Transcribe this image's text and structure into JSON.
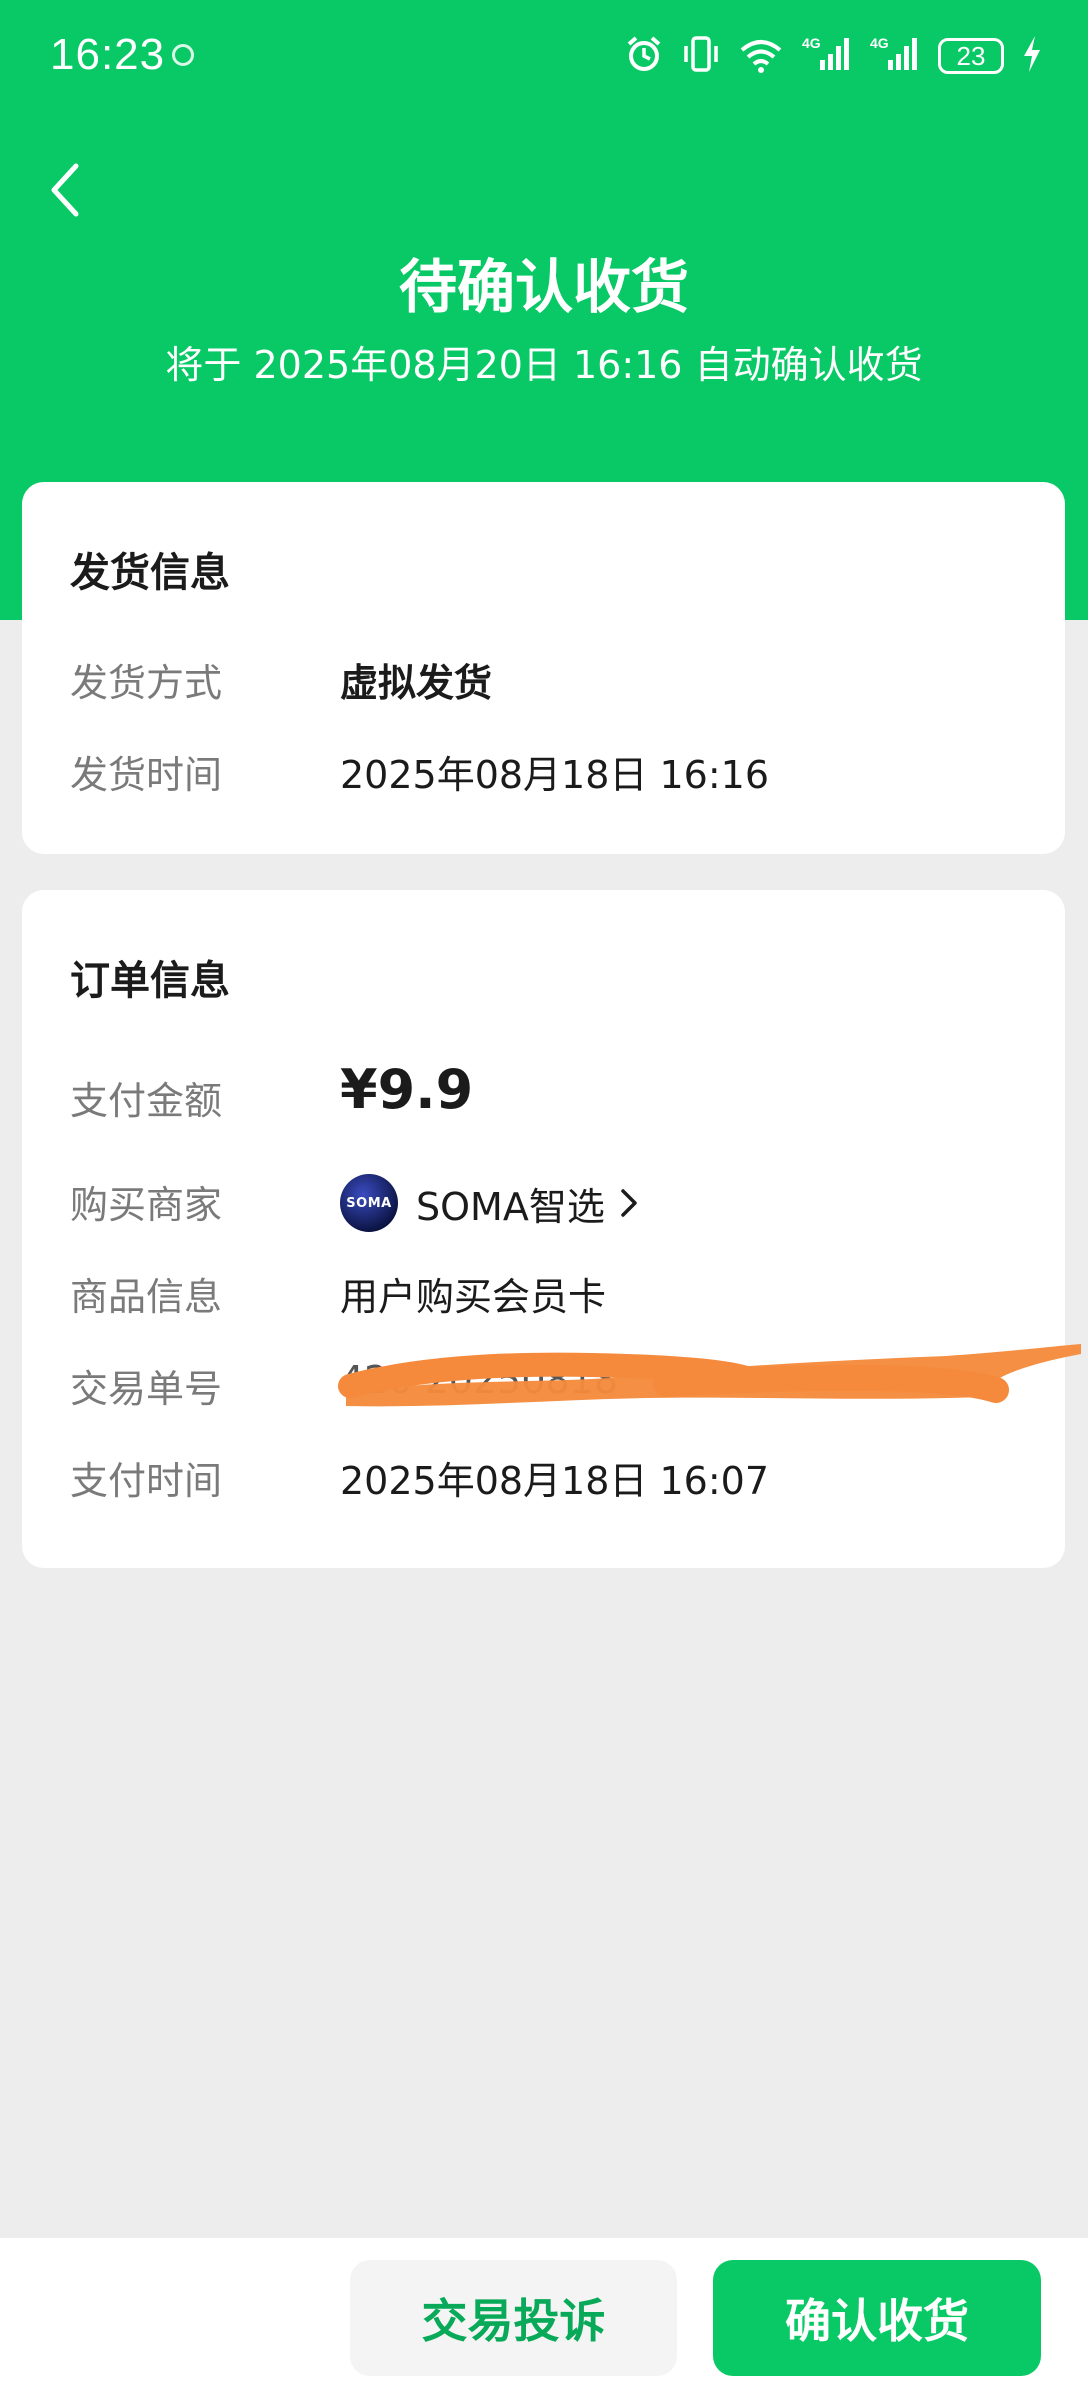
{
  "status_bar": {
    "time": "16:23",
    "network_1": "4G",
    "network_2": "4G",
    "battery": "23",
    "icons": [
      "alarm-icon",
      "vibrate-icon",
      "wifi-icon",
      "signal-icon",
      "signal-icon",
      "battery-icon",
      "charging-icon"
    ]
  },
  "header": {
    "title": "待确认收货",
    "subtitle": "将于 2025年08月20日 16:16 自动确认收货",
    "background_color": "#08c965"
  },
  "shipping": {
    "title": "发货信息",
    "rows": [
      {
        "label": "发货方式",
        "value": "虚拟发货"
      },
      {
        "label": "发货时间",
        "value": "2025年08月18日 16:16"
      }
    ]
  },
  "order": {
    "title": "订单信息",
    "payment_amount_label": "支付金额",
    "payment_amount": "¥9.9",
    "merchant_label": "购买商家",
    "merchant_logo_text": "SOMA",
    "merchant_name": "SOMA智选",
    "product_label": "商品信息",
    "product": "用户购买会员卡",
    "transaction_label": "交易单号",
    "transaction_visible": "420             20250818",
    "paytime_label": "支付时间",
    "paytime": "2025年08月18日 16:07"
  },
  "actions": {
    "complaint": "交易投诉",
    "confirm": "确认收货",
    "accent_color": "#08c965"
  }
}
